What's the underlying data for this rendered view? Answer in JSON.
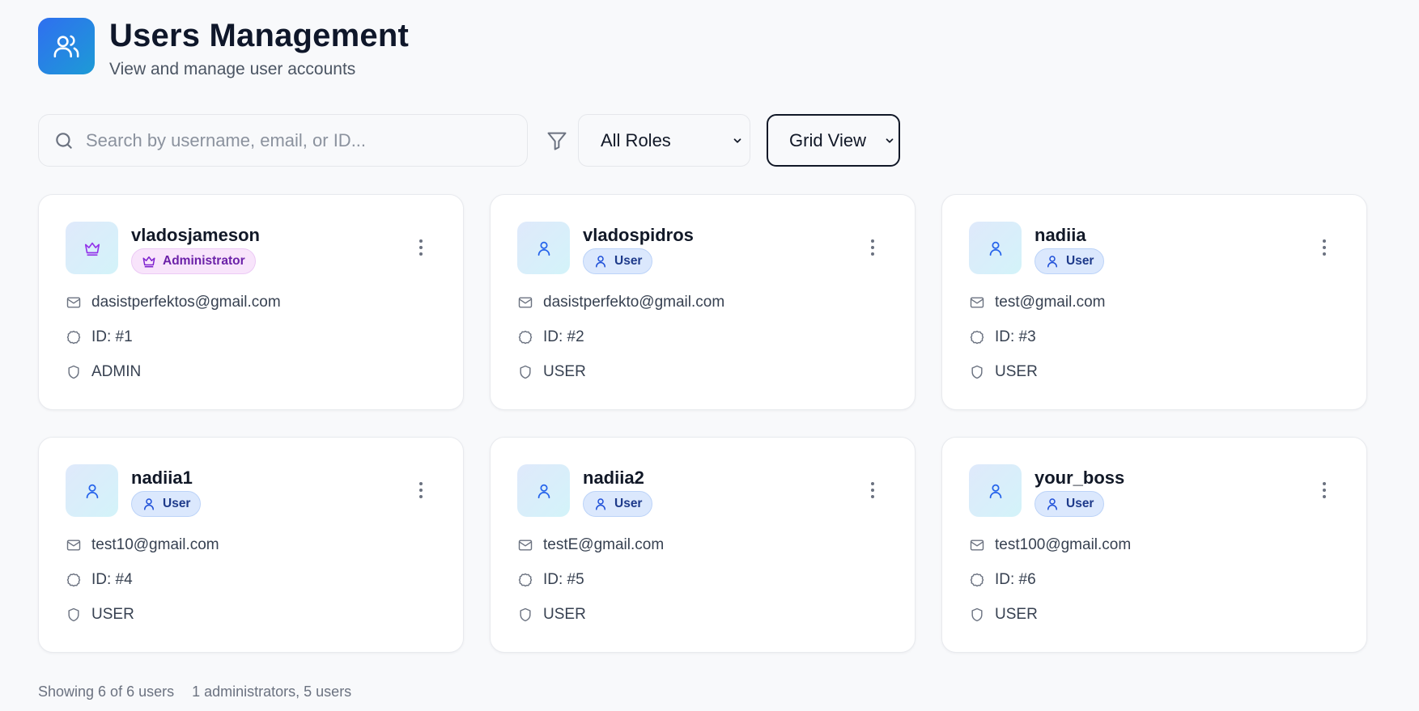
{
  "header": {
    "title": "Users Management",
    "subtitle": "View and manage user accounts",
    "logo_icon": "users-icon"
  },
  "toolbar": {
    "search_placeholder": "Search by username, email, or ID...",
    "search_value": "",
    "role_filter": "All Roles",
    "view_mode": "Grid View"
  },
  "colors": {
    "accent": "#2f6ff0",
    "admin_badge": "#f8e4fb",
    "user_badge": "#dbe8fd"
  },
  "users": [
    {
      "username": "vladosjameson",
      "role_label": "Administrator",
      "role_type": "admin",
      "email": "dasistperfektos@gmail.com",
      "id": "ID: #1",
      "role": "ADMIN"
    },
    {
      "username": "vladospidros",
      "role_label": "User",
      "role_type": "user",
      "email": "dasistperfekto@gmail.com",
      "id": "ID: #2",
      "role": "USER"
    },
    {
      "username": "nadiia",
      "role_label": "User",
      "role_type": "user",
      "email": "test@gmail.com",
      "id": "ID: #3",
      "role": "USER"
    },
    {
      "username": "nadiia1",
      "role_label": "User",
      "role_type": "user",
      "email": "test10@gmail.com",
      "id": "ID: #4",
      "role": "USER"
    },
    {
      "username": "nadiia2",
      "role_label": "User",
      "role_type": "user",
      "email": "testE@gmail.com",
      "id": "ID: #5",
      "role": "USER"
    },
    {
      "username": "your_boss",
      "role_label": "User",
      "role_type": "user",
      "email": "test100@gmail.com",
      "id": "ID: #6",
      "role": "USER"
    }
  ],
  "footer": {
    "showing": "Showing 6 of 6 users",
    "summary": "1 administrators, 5 users"
  }
}
